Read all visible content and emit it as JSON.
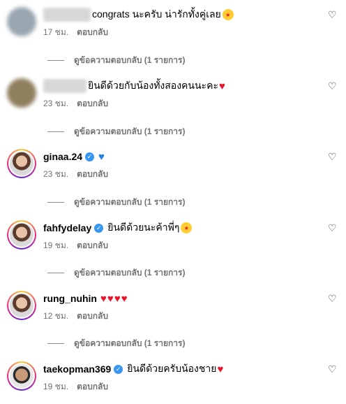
{
  "comments": [
    {
      "avatar": "blurred-avatar",
      "username_blurred": true,
      "text": "congrats นะครับ น่ารักทั้งคู่เลย",
      "emoji": "star-struck",
      "time": "17 ชม.",
      "reply_label": "ตอบกลับ",
      "view_replies": "ดูข้อความตอบกลับ (1 รายการ)"
    },
    {
      "avatar": "blurred-avatar",
      "username_blurred": true,
      "text": "ยินดีด้วยกับน้องทั้งสองคนนะคะ",
      "emoji": "red-heart",
      "time": "23 ชม.",
      "reply_label": "ตอบกลับ",
      "view_replies": "ดูข้อความตอบกลับ (1 รายการ)"
    },
    {
      "avatar": "profile-avatar",
      "username": "ginaa.24",
      "verified": true,
      "text": "",
      "emoji": "blue-heart",
      "time": "23 ชม.",
      "reply_label": "ตอบกลับ",
      "view_replies": "ดูข้อความตอบกลับ (1 รายการ)"
    },
    {
      "avatar": "profile-avatar",
      "username": "fahfydelay",
      "verified": true,
      "text": "ยินดีด้วยนะค้าพี่ๆ",
      "emoji": "star-struck",
      "time": "19 ชม.",
      "reply_label": "ตอบกลับ",
      "view_replies": "ดูข้อความตอบกลับ (1 รายการ)"
    },
    {
      "avatar": "profile-avatar",
      "username": "rung_nuhin",
      "verified": false,
      "text": "",
      "emoji": "four-red-hearts",
      "time": "12 ชม.",
      "reply_label": "ตอบกลับ",
      "view_replies": "ดูข้อความตอบกลับ (1 รายการ)"
    },
    {
      "avatar": "profile-avatar",
      "username": "taekopman369",
      "verified": true,
      "text": "ยินดีด้วยครับน้องชาย",
      "emoji": "red-heart",
      "time": "19 ชม.",
      "reply_label": "ตอบกลับ",
      "view_replies": ""
    }
  ],
  "icons": {
    "like": "heart-outline-icon",
    "verified": "verified-badge-icon"
  },
  "colors": {
    "verified": "#3897f0",
    "heart": "#e8152e",
    "blue_heart": "#1d7de3",
    "meta_text": "#737373"
  }
}
